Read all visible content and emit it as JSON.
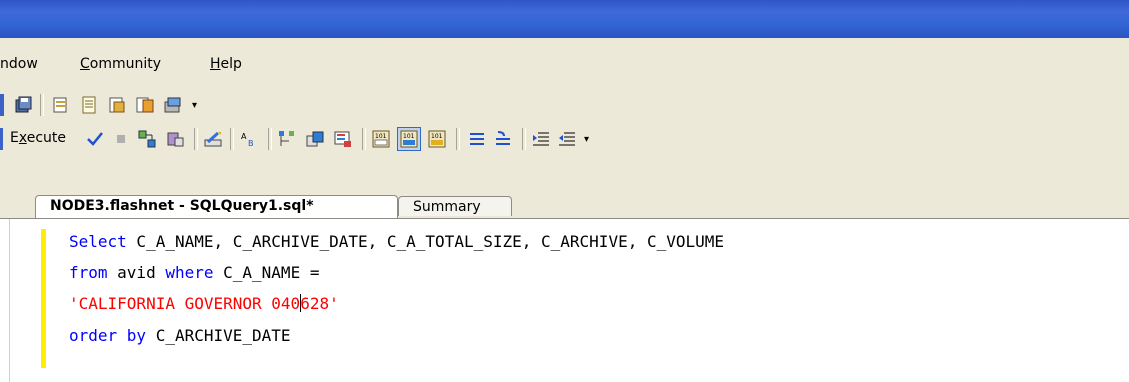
{
  "menu": {
    "window_label": "ndow",
    "community_label": "Community",
    "community_underline": "C",
    "community_rest": "ommunity",
    "help_underline": "H",
    "help_rest": "elp"
  },
  "toolbar": {
    "execute_underline": "x",
    "execute_prefix": "E",
    "execute_rest": "ecute",
    "overflow_glyph": "▾"
  },
  "tabs": [
    {
      "label": "NODE3.flashnet - SQLQuery1.sql*",
      "active": true
    },
    {
      "label": "Summary",
      "active": false
    }
  ],
  "editor": {
    "line1": {
      "kw": "Select",
      "rest": " C_A_NAME, C_ARCHIVE_DATE, C_A_TOTAL_SIZE, C_ARCHIVE, C_VOLUME"
    },
    "line2": {
      "kw1": "from",
      "mid": " avid ",
      "kw2": "where",
      "rest": " C_A_NAME ="
    },
    "line3": {
      "str_before_caret": "'CALIFORNIA GOVERNOR 040",
      "str_after_caret": "628'"
    },
    "line4": {
      "kw": "order by",
      "rest": " C_ARCHIVE_DATE"
    }
  },
  "colors": {
    "titlebar": "#3466d6",
    "keyword": "#0000ff",
    "string": "#ff0000",
    "margin_marker": "#ffee00"
  }
}
